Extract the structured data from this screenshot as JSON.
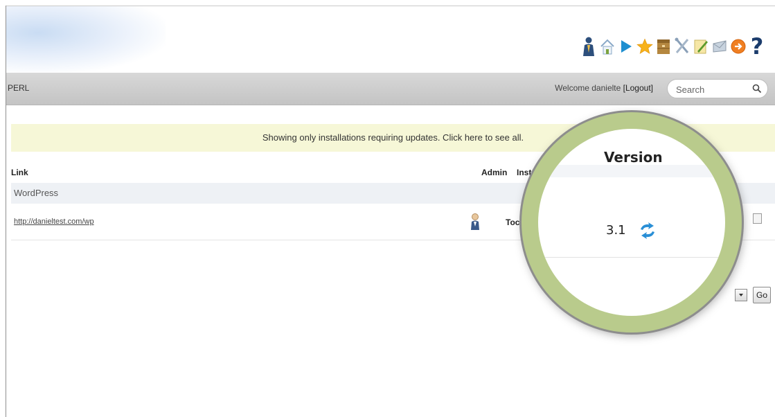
{
  "header": {
    "toolbar_icons": [
      "user-icon",
      "home-icon",
      "play-icon",
      "star-icon",
      "archive-icon",
      "tools-icon",
      "edit-icon",
      "mail-icon",
      "logout-icon",
      "help-icon"
    ],
    "help_glyph": "?"
  },
  "navbar": {
    "breadcrumb": "PERL",
    "welcome_prefix": "Welcome danielte ",
    "logout_label": "[Logout]",
    "search_placeholder": "Search"
  },
  "notice": {
    "text": "Showing only installations requiring updates. Click here to see all."
  },
  "table": {
    "headers": {
      "link": "Link",
      "admin": "Admin",
      "installed": "Inst"
    },
    "groups": [
      {
        "name": "WordPress",
        "rows": [
          {
            "link": "http://danieltest.com/wp",
            "installed": "Toc",
            "version": "3.1"
          }
        ]
      }
    ]
  },
  "bulk": {
    "go_label": "Go"
  },
  "magnifier": {
    "title": "Version",
    "version": "3.1"
  },
  "colors": {
    "notice_bg": "#f6f7d7",
    "navbar_bg": "#c9c9c9",
    "magnifier_ring": "#b9cb8c",
    "update_icon": "#2a8fd6"
  }
}
